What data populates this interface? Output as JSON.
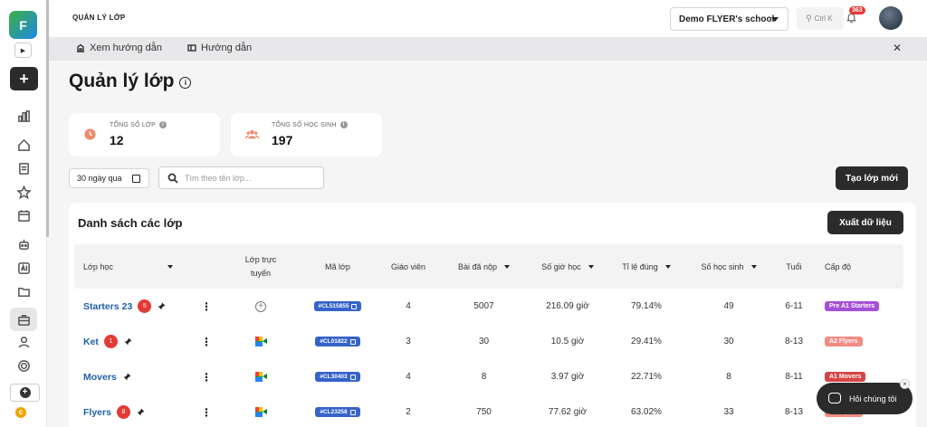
{
  "header": {
    "title": "QUẢN LÝ LỚP",
    "school": "Demo FLYER's school",
    "search_shortcut": "Ctrl K",
    "notification_count": "363"
  },
  "guide_bar": {
    "item1": "Xem hướng dẫn",
    "item2": "Hướng dẫn"
  },
  "page": {
    "title": "Quản lý lớp"
  },
  "stats": {
    "classes": {
      "label": "TỔNG SỐ LỚP",
      "value": "12",
      "color": "#ef8a6b"
    },
    "students": {
      "label": "TỔNG SỐ HỌC SINH",
      "value": "197",
      "color": "#ef8a6b"
    }
  },
  "filters": {
    "date_range": "30 ngày qua",
    "search_placeholder": "Tìm theo tên lớp...",
    "create_label": "Tạo lớp mới"
  },
  "table": {
    "title": "Danh sách các lớp",
    "export_label": "Xuất dữ liệu",
    "headers": {
      "class": "Lớp học",
      "online_1": "Lớp trực",
      "online_2": "tuyến",
      "code": "Mã lớp",
      "teachers": "Giáo viên",
      "submissions": "Bài đã nộp",
      "hours": "Số giờ học",
      "accuracy": "Tỉ lệ đúng",
      "students": "Số học sinh",
      "age": "Tuổi",
      "level": "Cấp độ"
    },
    "rows": [
      {
        "name": "Starters 23",
        "badge": "5",
        "online": "plus",
        "code": "#CL515855",
        "teachers": "4",
        "submissions": "5007",
        "hours": "216.09 giờ",
        "accuracy": "79.14%",
        "students": "49",
        "age": "6-11",
        "level": "Pre A1 Starters",
        "level_color": "#a64fd6"
      },
      {
        "name": "Ket",
        "badge": "1",
        "online": "meet",
        "code": "#CL01822",
        "teachers": "3",
        "submissions": "30",
        "hours": "10.5 giờ",
        "accuracy": "29.41%",
        "students": "30",
        "age": "8-13",
        "level": "A2 Flyers",
        "level_color": "#f28b82"
      },
      {
        "name": "Movers",
        "badge": "",
        "online": "meet",
        "code": "#CL30403",
        "teachers": "4",
        "submissions": "8",
        "hours": "3.97 giờ",
        "accuracy": "22.71%",
        "students": "8",
        "age": "8-11",
        "level": "A1 Movers",
        "level_color": "#d64545"
      },
      {
        "name": "Flyers",
        "badge": "8",
        "online": "meet",
        "code": "#CL23258",
        "teachers": "2",
        "submissions": "750",
        "hours": "77.62 giờ",
        "accuracy": "63.02%",
        "students": "33",
        "age": "8-13",
        "level": "A2 Flyers",
        "level_color": "#f28b82"
      }
    ]
  },
  "chat": {
    "label": "Hỏi chúng tôi"
  }
}
